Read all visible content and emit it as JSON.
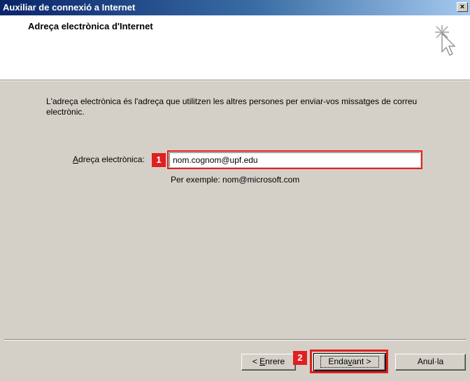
{
  "window": {
    "title": "Auxiliar de connexió a Internet",
    "close_label": "×"
  },
  "header": {
    "heading": "Adreça electrònica d'Internet",
    "icon": "wizard-cursor-icon"
  },
  "main": {
    "description": "L'adreça electrònica és l'adreça que utilitzen les altres persones per enviar-vos missatges de correu electrònic.",
    "email_label_accesskey": "A",
    "email_label_rest": "dreça electrònica:",
    "email_value": "nom.cognom@upf.edu",
    "example_text": "Per exemple: nom@microsoft.com"
  },
  "annotations": {
    "badge1": "1",
    "badge2": "2",
    "highlight_color": "#e02020"
  },
  "buttons": {
    "back_prefix": "< ",
    "back_accesskey": "E",
    "back_rest": "nrere",
    "next_prefix": "Enda",
    "next_accesskey": "v",
    "next_rest": "ant >",
    "cancel_label": "Anul·la"
  }
}
